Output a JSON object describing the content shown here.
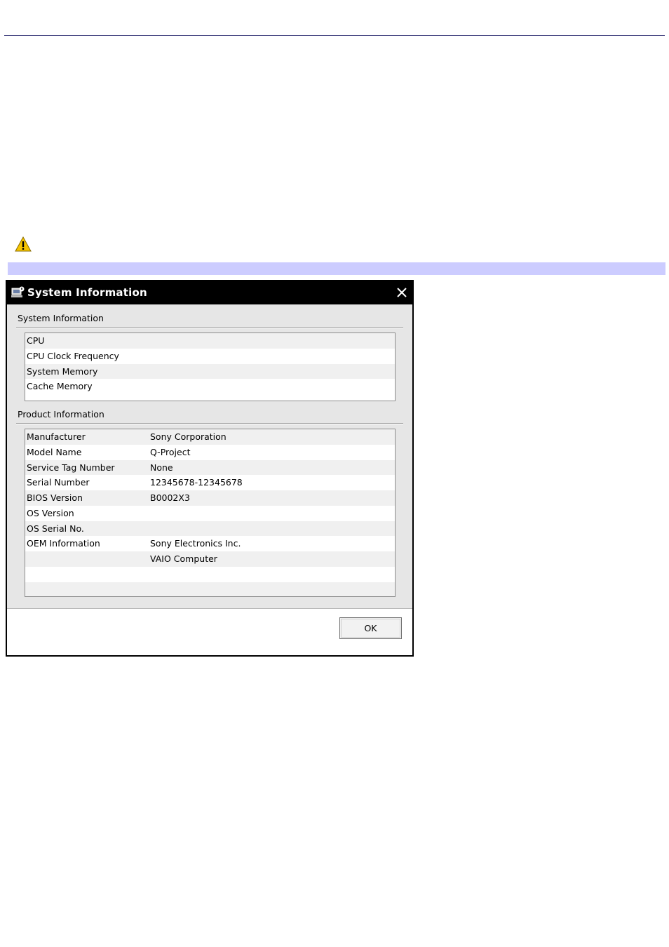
{
  "dialog": {
    "title": "System Information",
    "ok_label": "OK"
  },
  "system_section": {
    "label": "System Information",
    "rows": [
      {
        "key": "CPU",
        "value": ""
      },
      {
        "key": "CPU Clock Frequency",
        "value": ""
      },
      {
        "key": "System Memory",
        "value": ""
      },
      {
        "key": "Cache Memory",
        "value": ""
      }
    ]
  },
  "product_section": {
    "label": "Product Information",
    "rows": [
      {
        "key": "Manufacturer",
        "value": "Sony Corporation"
      },
      {
        "key": "Model Name",
        "value": "Q-Project"
      },
      {
        "key": "Service Tag Number",
        "value": "None"
      },
      {
        "key": "Serial Number",
        "value": "12345678-12345678"
      },
      {
        "key": "BIOS Version",
        "value": "B0002X3"
      },
      {
        "key": "OS Version",
        "value": ""
      },
      {
        "key": "OS Serial No.",
        "value": ""
      },
      {
        "key": "OEM Information",
        "value": "Sony Electronics Inc."
      },
      {
        "key": "",
        "value": "VAIO Computer"
      },
      {
        "key": "",
        "value": ""
      },
      {
        "key": "",
        "value": ""
      }
    ]
  },
  "icons": {
    "warning": "warning-triangle-icon",
    "app": "computer-info-icon",
    "close": "close-icon"
  },
  "colors": {
    "note_bar": "#ccccff",
    "title_bar": "#000000",
    "warning": "#f5c400"
  }
}
